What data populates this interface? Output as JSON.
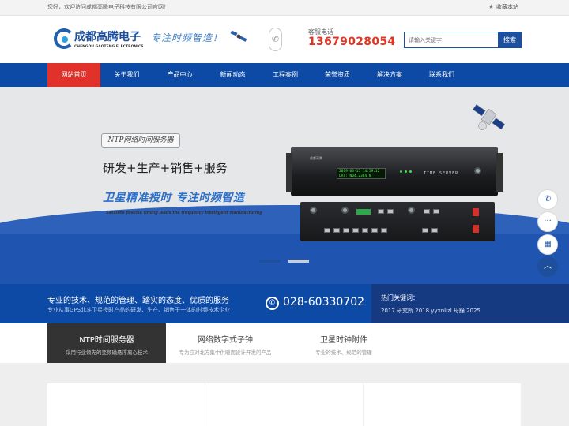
{
  "topbar": {
    "welcome": "您好，欢迎访问成都高腾电子科技有限公司官网！",
    "favorite": "收藏本站"
  },
  "header": {
    "logo_cn": "成都高腾电子",
    "logo_en": "CHENGDU GAOTENG ELECTRONICS",
    "slogan": "专注时频智造！",
    "hotline_label": "客服电话",
    "hotline": "13679028054",
    "search_placeholder": "请输入关键字",
    "search_button": "搜索"
  },
  "nav": {
    "items": [
      {
        "label": "网站首页",
        "active": true
      },
      {
        "label": "关于我们"
      },
      {
        "label": "产品中心"
      },
      {
        "label": "新闻动态"
      },
      {
        "label": "工程案例"
      },
      {
        "label": "荣誉资质"
      },
      {
        "label": "解决方案"
      },
      {
        "label": "联系我们"
      }
    ]
  },
  "banner": {
    "tag": "NTP网络时间服务器",
    "headline": "研发+生产+销售+服务",
    "slogan": "卫星精准授时  专注时频智造",
    "english": "Satellite precise timing leads the frequency intelligent manufacturing",
    "server_label": "TIME  SERVER",
    "server_brand": "成都高腾",
    "lcd_line1": "2019-03-15 14:59:12",
    "lcd_line2": "LAT: N04.2364  N"
  },
  "info": {
    "title": "专业的技术、规范的管理、踏实的态度、优质的服务",
    "sub": "专业从事GPS北斗卫星授时产品的研发、生产、销售于一体的时频技术企业",
    "phone": "028-60330702",
    "hot_label": "热门关键词：",
    "hot_words": "2017 研究所 2018 yyxnlizl 母鐘 2025"
  },
  "tabs": [
    {
      "title": "NTP时间服务器",
      "sub": "采用行业领先的变频磁悬浮离心技术",
      "active": true
    },
    {
      "title": "网络数字式子钟",
      "sub": "专为应对北方集中供暖而设计开发的产品"
    },
    {
      "title": "卫星时钟附件",
      "sub": "专业的技术、规范的管理"
    }
  ],
  "icons": {
    "phone": "phone-icon",
    "chat": "chat-icon",
    "qrcode": "qrcode-icon",
    "back_top": "arrow-up-icon",
    "star": "star-icon"
  },
  "colors": {
    "nav_blue": "#0c4aa6",
    "active_red": "#e0322a",
    "hotline_red": "#e03524",
    "brand_blue": "#1e4f9c"
  }
}
